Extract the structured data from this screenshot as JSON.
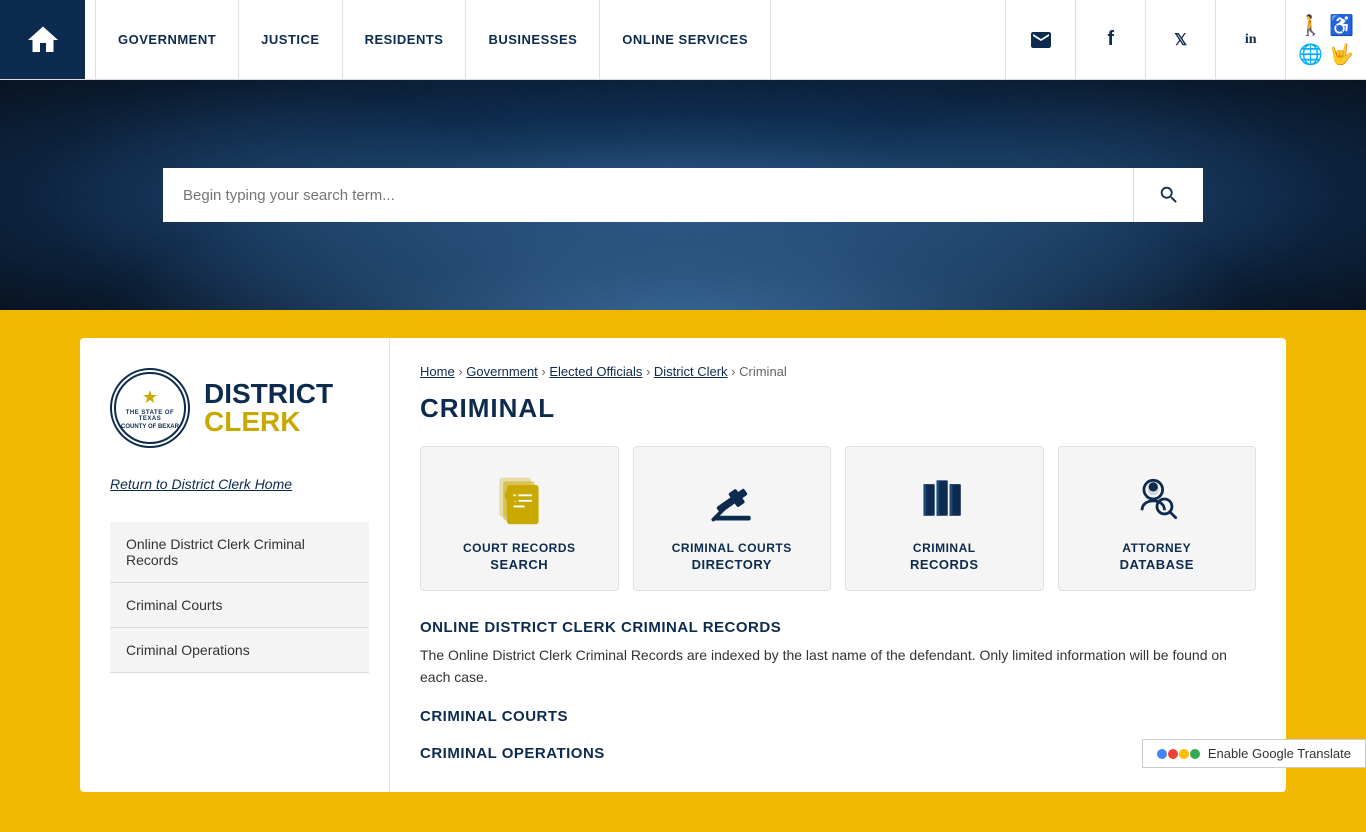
{
  "nav": {
    "home_label": "Home",
    "links": [
      {
        "label": "GOVERNMENT",
        "id": "government"
      },
      {
        "label": "JUSTICE",
        "id": "justice"
      },
      {
        "label": "RESIDENTS",
        "id": "residents"
      },
      {
        "label": "BUSINESSES",
        "id": "businesses"
      },
      {
        "label": "ONLINE SERVICES",
        "id": "online-services"
      }
    ],
    "social": [
      {
        "label": "Email",
        "icon": "✉",
        "id": "email"
      },
      {
        "label": "Facebook",
        "icon": "f",
        "id": "facebook"
      },
      {
        "label": "Twitter",
        "icon": "𝕏",
        "id": "twitter"
      },
      {
        "label": "LinkedIn",
        "icon": "in",
        "id": "linkedin"
      }
    ]
  },
  "search": {
    "placeholder": "Begin typing your search term..."
  },
  "breadcrumb": {
    "items": [
      "Home",
      "Government",
      "Elected Officials",
      "District Clerk"
    ],
    "current": "Criminal"
  },
  "page": {
    "title": "CRIMINAL"
  },
  "sidebar": {
    "district": "DISTRICT",
    "clerk": "CLERK",
    "return_link": "Return to District Clerk Home",
    "nav_items": [
      {
        "label": "Online District Clerk Criminal Records",
        "id": "online-records"
      },
      {
        "label": "Criminal Courts",
        "id": "criminal-courts"
      },
      {
        "label": "Criminal Operations",
        "id": "criminal-operations"
      }
    ]
  },
  "cards": [
    {
      "id": "court-records",
      "label_top": "COURT RECORDS",
      "label_bot": "SEARCH",
      "icon": "court-records-icon"
    },
    {
      "id": "criminal-courts",
      "label_top": "CRIMINAL COURTS",
      "label_bot": "DIRECTORY",
      "icon": "criminal-courts-icon"
    },
    {
      "id": "criminal-records",
      "label_top": "CRIMINAL",
      "label_bot": "RECORDS",
      "icon": "criminal-records-icon"
    },
    {
      "id": "attorney-database",
      "label_top": "ATTORNEY",
      "label_bot": "DATABASE",
      "icon": "attorney-database-icon"
    }
  ],
  "sections": [
    {
      "id": "online-district",
      "heading": "ONLINE DISTRICT CLERK CRIMINAL RECORDS",
      "text": "The Online District Clerk Criminal Records are indexed by the last name of the defendant. Only limited information will be found on each case."
    },
    {
      "id": "criminal-courts-section",
      "heading": "CRIMINAL COURTS"
    },
    {
      "id": "criminal-operations-section",
      "heading": "CRIMINAL OPERATIONS"
    }
  ],
  "footer": {
    "translate_label": "Enable Google Translate"
  },
  "seal": {
    "text_top": "THE STATE OF TEXAS",
    "text_bot": "COUNTY OF BEXAR"
  }
}
